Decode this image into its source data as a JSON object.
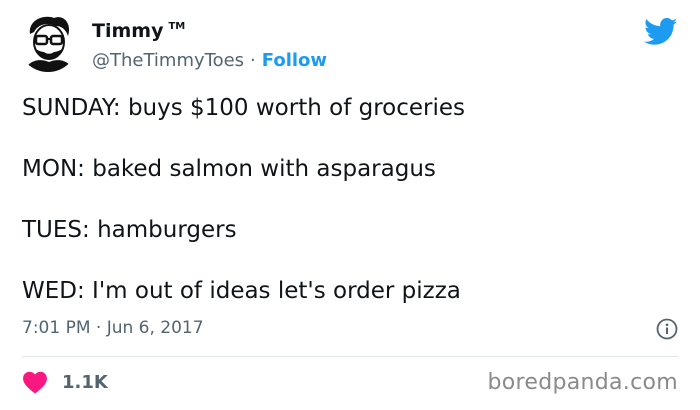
{
  "author": {
    "display_name": "Timmy",
    "trademark": "TM",
    "handle": "@TheTimmyToes",
    "separator": "·",
    "follow_label": "Follow"
  },
  "tweet": {
    "lines": [
      "SUNDAY: buys $100 worth of groceries",
      "MON: baked salmon with asparagus",
      "TUES: hamburgers",
      "WED: I'm out of ideas let's order pizza"
    ],
    "timestamp": "7:01 PM · Jun 6, 2017",
    "like_count": "1.1K"
  },
  "footer": {
    "watermark": "boredpanda.com"
  },
  "icons": {
    "brand": "twitter-bird-icon",
    "info": "info-icon",
    "like": "heart-icon"
  },
  "colors": {
    "accent": "#1d9bf0",
    "heart": "#f91880",
    "muted": "#536471",
    "text": "#0f1419"
  }
}
